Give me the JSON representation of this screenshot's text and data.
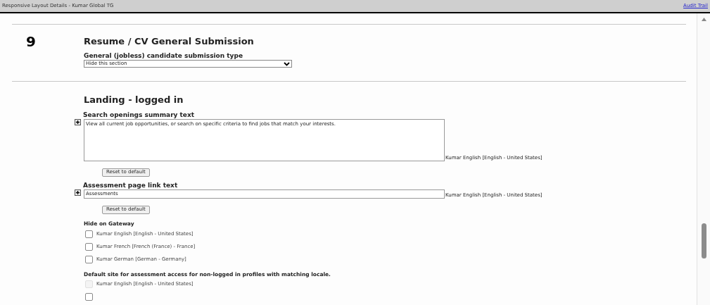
{
  "header": {
    "title": "Responsive Layout Details - Kumar Global TG",
    "link": "Audit Trail"
  },
  "section": {
    "number": "9",
    "title": "Resume / CV General Submission",
    "field_label": "General (jobless) candidate submission type",
    "select_value": "Hide this section"
  },
  "landing": {
    "title": "Landing - logged in",
    "fields": [
      {
        "kind": "textarea",
        "label": "Search openings summary text",
        "value": "View all current job opportunities, or search on specific criteria to find jobs that match your interests.",
        "locale": "Kumar English [English - United States]",
        "button": "Reset to default"
      },
      {
        "kind": "input",
        "label": "Assessment page link text",
        "value": "Assessments",
        "locale": "Kumar English [English - United States]",
        "button": "Reset to default"
      }
    ],
    "groups": [
      {
        "label": "Hide on Gateway",
        "options": [
          {
            "label": "Kumar English [English - United States]",
            "checked": false,
            "disabled": false
          },
          {
            "label": "Kumar French [French (France) - France]",
            "checked": false,
            "disabled": false
          },
          {
            "label": "Kumar German [German - Germany]",
            "checked": false,
            "disabled": false
          }
        ]
      },
      {
        "label": "Default site for assessment access for non-logged in profiles with matching locale.",
        "options": [
          {
            "label": "Kumar English [English - United States]",
            "checked": false,
            "disabled": true
          },
          {
            "checked": false,
            "disabled": false
          }
        ]
      }
    ]
  }
}
